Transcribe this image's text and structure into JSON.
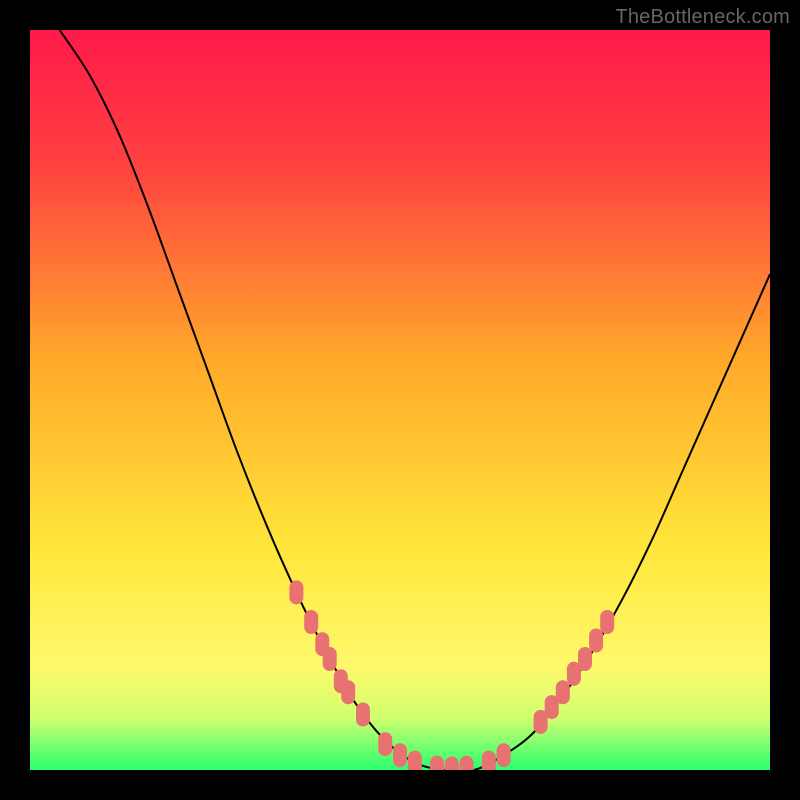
{
  "watermark": "TheBottleneck.com",
  "chart_data": {
    "type": "line",
    "title": "",
    "xlabel": "",
    "ylabel": "",
    "xlim": [
      0,
      100
    ],
    "ylim": [
      0,
      100
    ],
    "background_gradient": {
      "top_color": "#ff1a4a",
      "mid_color": "#ffe63b",
      "bottom_color": "#2bff6e"
    },
    "series": [
      {
        "name": "bottleneck-curve",
        "color": "#000000",
        "points": [
          {
            "x": 4,
            "y": 100
          },
          {
            "x": 8,
            "y": 94
          },
          {
            "x": 12,
            "y": 86
          },
          {
            "x": 16,
            "y": 76
          },
          {
            "x": 20,
            "y": 65
          },
          {
            "x": 24,
            "y": 54
          },
          {
            "x": 28,
            "y": 43
          },
          {
            "x": 32,
            "y": 33
          },
          {
            "x": 36,
            "y": 24
          },
          {
            "x": 40,
            "y": 16
          },
          {
            "x": 44,
            "y": 9
          },
          {
            "x": 48,
            "y": 4
          },
          {
            "x": 52,
            "y": 1
          },
          {
            "x": 56,
            "y": 0
          },
          {
            "x": 60,
            "y": 0
          },
          {
            "x": 64,
            "y": 2
          },
          {
            "x": 68,
            "y": 5
          },
          {
            "x": 72,
            "y": 10
          },
          {
            "x": 76,
            "y": 16
          },
          {
            "x": 80,
            "y": 23
          },
          {
            "x": 84,
            "y": 31
          },
          {
            "x": 88,
            "y": 40
          },
          {
            "x": 92,
            "y": 49
          },
          {
            "x": 96,
            "y": 58
          },
          {
            "x": 100,
            "y": 67
          }
        ]
      }
    ],
    "markers": [
      {
        "x": 36,
        "y": 24
      },
      {
        "x": 38,
        "y": 20
      },
      {
        "x": 39.5,
        "y": 17
      },
      {
        "x": 40.5,
        "y": 15
      },
      {
        "x": 42,
        "y": 12
      },
      {
        "x": 43,
        "y": 10.5
      },
      {
        "x": 45,
        "y": 7.5
      },
      {
        "x": 48,
        "y": 3.5
      },
      {
        "x": 50,
        "y": 2
      },
      {
        "x": 52,
        "y": 1
      },
      {
        "x": 55,
        "y": 0.3
      },
      {
        "x": 57,
        "y": 0.2
      },
      {
        "x": 59,
        "y": 0.3
      },
      {
        "x": 62,
        "y": 1
      },
      {
        "x": 64,
        "y": 2
      },
      {
        "x": 69,
        "y": 6.5
      },
      {
        "x": 70.5,
        "y": 8.5
      },
      {
        "x": 72,
        "y": 10.5
      },
      {
        "x": 73.5,
        "y": 13
      },
      {
        "x": 75,
        "y": 15
      },
      {
        "x": 76.5,
        "y": 17.5
      },
      {
        "x": 78,
        "y": 20
      }
    ],
    "marker_color": "#e87272"
  }
}
